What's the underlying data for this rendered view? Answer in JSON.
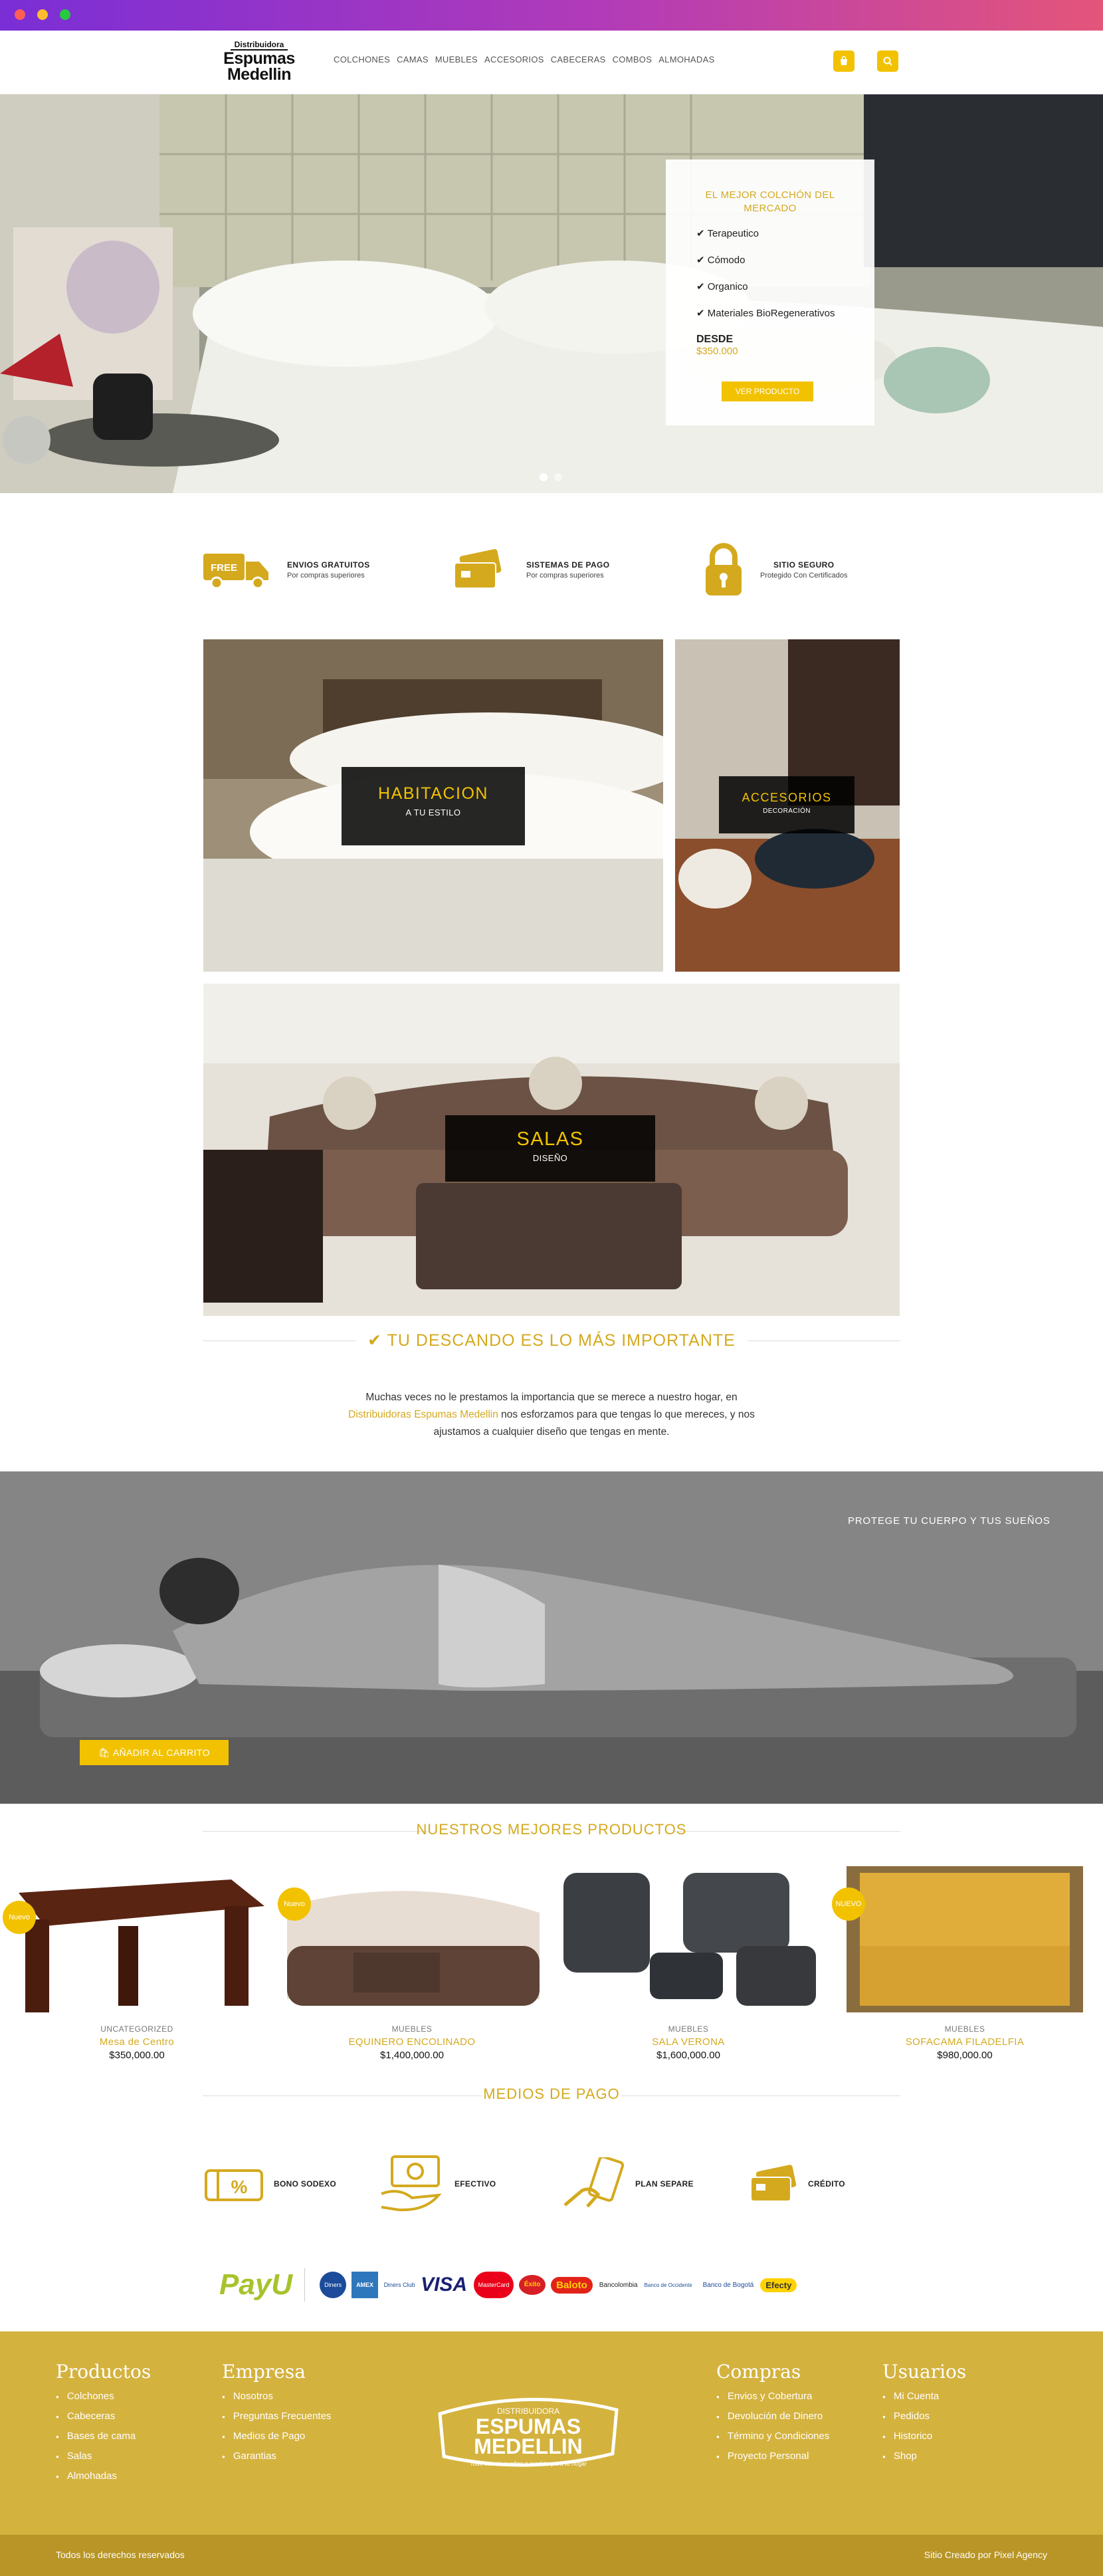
{
  "brand": {
    "line1": "Distribuidora",
    "line2": "Espumas",
    "line3": "Medellin"
  },
  "nav": {
    "items": [
      "COLCHONES",
      "CAMAS",
      "MUEBLES",
      "ACCESORIOS",
      "CABECERAS",
      "COMBOS",
      "ALMOHADAS"
    ]
  },
  "header_icons": {
    "cart": "cart-icon",
    "search": "search-icon"
  },
  "colors": {
    "accent": "#f2c200",
    "gold": "#d4a91e",
    "footer": "#d4b23e",
    "footer_bar": "#b89526"
  },
  "hero": {
    "card_title": "EL MEJOR COLCHÓN DEL MERCADO",
    "features": [
      "Terapeutico",
      "Cómodo",
      "Organico",
      "Materiales BioRegenerativos"
    ],
    "desde": "DESDE",
    "price": "$350.000",
    "button": "VER PRODUCTO",
    "slides": 2,
    "active_slide": 1
  },
  "features": [
    {
      "icon": "free-truck-icon",
      "title": "ENVIOS GRATUITOS",
      "subtitle": "Por compras superiores"
    },
    {
      "icon": "credit-card-icon",
      "title": "SISTEMAS DE PAGO",
      "subtitle": "Por compras superiores"
    },
    {
      "icon": "lock-icon",
      "title": "SITIO SEGURO",
      "subtitle": "Protegido Con Certificados"
    }
  ],
  "free_badge": "FREE",
  "categories": [
    {
      "title": "HABITACION",
      "subtitle": "A TU ESTILO"
    },
    {
      "title": "ACCESORIOS",
      "subtitle": "DECORACIÓN"
    },
    {
      "title": "SALAS",
      "subtitle": "DISEÑO"
    }
  ],
  "about": {
    "heading": "TU DESCANDO ES LO MÁS IMPORTANTE",
    "text_before": "Muchas veces no le prestamos la importancia que se merece a nuestro hogar, en",
    "highlight": "Distribuidoras Espumas Medellin",
    "text_after": "nos esforzamos para que tengas lo que mereces, y nos ajustamos a cualquier diseño que tengas en mente."
  },
  "banner": {
    "title": "PROTEGE TU CUERPO Y TUS SUEÑOS",
    "button": "AÑADIR AL CARRITO"
  },
  "products_heading": "NUESTROS MEJORES PRODUCTOS",
  "products": [
    {
      "badge": "Nuevo",
      "category": "UNCATEGORIZED",
      "name": "Mesa de Centro",
      "price": "$350,000.00"
    },
    {
      "badge": "Nuevo",
      "category": "MUEBLES",
      "name": "EQUINERO ENCOLINADO",
      "price": "$1,400,000.00"
    },
    {
      "badge": "",
      "category": "MUEBLES",
      "name": "SALA VERONA",
      "price": "$1,600,000.00"
    },
    {
      "badge": "NUEVO",
      "category": "MUEBLES",
      "name": "SOFACAMA FILADELFIA",
      "price": "$980,000.00"
    }
  ],
  "payments_heading": "MEDIOS DE PAGO",
  "payments": [
    {
      "icon": "percent-card-icon",
      "label": "BONO SODEXO"
    },
    {
      "icon": "cash-hand-icon",
      "label": "EFECTIVO"
    },
    {
      "icon": "phone-hand-icon",
      "label": "PLAN SEPARE"
    },
    {
      "icon": "card-icon",
      "label": "CRÉDITO"
    }
  ],
  "payment_logos": [
    "PayU",
    "Diners",
    "AMEX",
    "Diners Club",
    "VISA",
    "MasterCard",
    "Éxito",
    "Baloto",
    "Bancolombia",
    "Banco de Occidente",
    "Banco de Bogotá",
    "Efecty"
  ],
  "footer": {
    "productos": {
      "title": "Productos",
      "items": [
        "Colchones",
        "Cabeceras",
        "Bases de cama",
        "Salas",
        "Almohadas"
      ]
    },
    "empresa": {
      "title": "Empresa",
      "items": [
        "Nosotros",
        "Preguntas Frecuentes",
        "Medios de Pago",
        "Garantias"
      ]
    },
    "logo": {
      "top": "DISTRIBUIDORA",
      "line1": "ESPUMAS",
      "line2": "MEDELLIN",
      "tag": "Todo cuanto sueñas a medida para tu hogar"
    },
    "compras": {
      "title": "Compras",
      "items": [
        "Envios y Cobertura",
        "Devolución de Dinero",
        "Término y Condiciones",
        "Proyecto Personal"
      ]
    },
    "usuarios": {
      "title": "Usuarios",
      "items": [
        "Mi Cuenta",
        "Pedidos",
        "Historico",
        "Shop"
      ]
    },
    "copyright": "Todos los derechos reservados",
    "credit": "Sitio Creado por Pixel Agency"
  }
}
